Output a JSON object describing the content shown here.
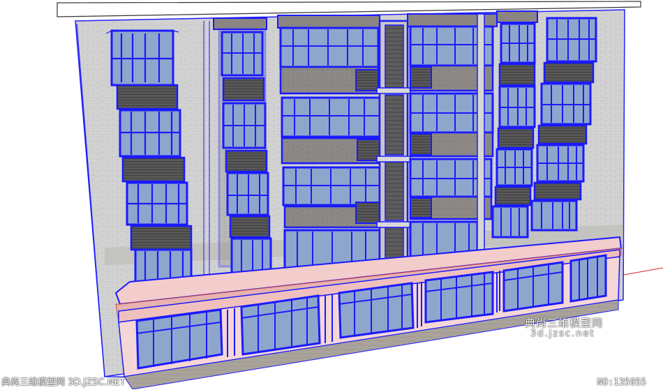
{
  "watermark": {
    "brand_cn": "典尚三维模型网",
    "brand_url": "3d.jzsc.net"
  },
  "footer": {
    "left_text": "典尚三维模型网 3D.JZSC.NET",
    "id_label": "NO:135955"
  },
  "colors": {
    "sky": "#ffffff",
    "wall": "#cfcfcf",
    "edge": "#1a1aff",
    "glass": "#7f9fc8",
    "shutter": "#595959",
    "trim": "#efc9c9",
    "axis_red": "#cc2222"
  }
}
